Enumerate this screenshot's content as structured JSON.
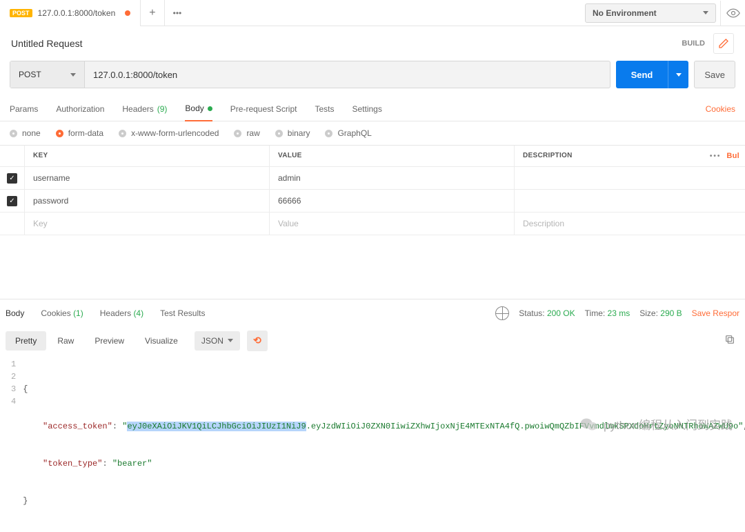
{
  "topbar": {
    "tab_method": "POST",
    "tab_label": "127.0.0.1:8000/token",
    "env_label": "No Environment"
  },
  "title": "Untitled Request",
  "title_actions": {
    "build": "BUILD"
  },
  "request": {
    "method": "POST",
    "url": "127.0.0.1:8000/token",
    "send": "Send",
    "save": "Save"
  },
  "reqtabs": {
    "params": "Params",
    "auth": "Authorization",
    "headers": "Headers",
    "headers_count": "(9)",
    "body": "Body",
    "prereq": "Pre-request Script",
    "tests": "Tests",
    "settings": "Settings",
    "cookies": "Cookies"
  },
  "bodytypes": {
    "none": "none",
    "formdata": "form-data",
    "xform": "x-www-form-urlencoded",
    "raw": "raw",
    "binary": "binary",
    "graphql": "GraphQL"
  },
  "table": {
    "h_key": "KEY",
    "h_value": "VALUE",
    "h_desc": "DESCRIPTION",
    "bulk": "Bul",
    "rows": [
      {
        "k": "username",
        "v": "admin",
        "d": ""
      },
      {
        "k": "password",
        "v": "66666",
        "d": ""
      }
    ],
    "ph_key": "Key",
    "ph_val": "Value",
    "ph_desc": "Description"
  },
  "response": {
    "tabs": {
      "body": "Body",
      "cookies": "Cookies",
      "cookies_count": "(1)",
      "headers": "Headers",
      "headers_count": "(4)",
      "tests": "Test Results"
    },
    "status_l": "Status:",
    "status_v": "200 OK",
    "time_l": "Time:",
    "time_v": "23 ms",
    "size_l": "Size:",
    "size_v": "290 B",
    "save": "Save Respor",
    "views": {
      "pretty": "Pretty",
      "raw": "Raw",
      "preview": "Preview",
      "visualize": "Visualize"
    },
    "format": "JSON",
    "json": {
      "k1": "\"access_token\"",
      "v1a": "eyJ0eXAiOiJKV1QiLCJhbGciOiJIUzI1NiJ9",
      "v1b": ".eyJzdWIiOiJ0ZXN0IiwiZXhwIjoxNjE4MTExNTA4fQ.pwoiwQmQZbIFVvmdlmkSPXdoHrtZyoNNTRhoWAZWU9o",
      "k2": "\"token_type\"",
      "v2": "\"bearer\""
    }
  },
  "watermark": "python编程从入门到实践"
}
